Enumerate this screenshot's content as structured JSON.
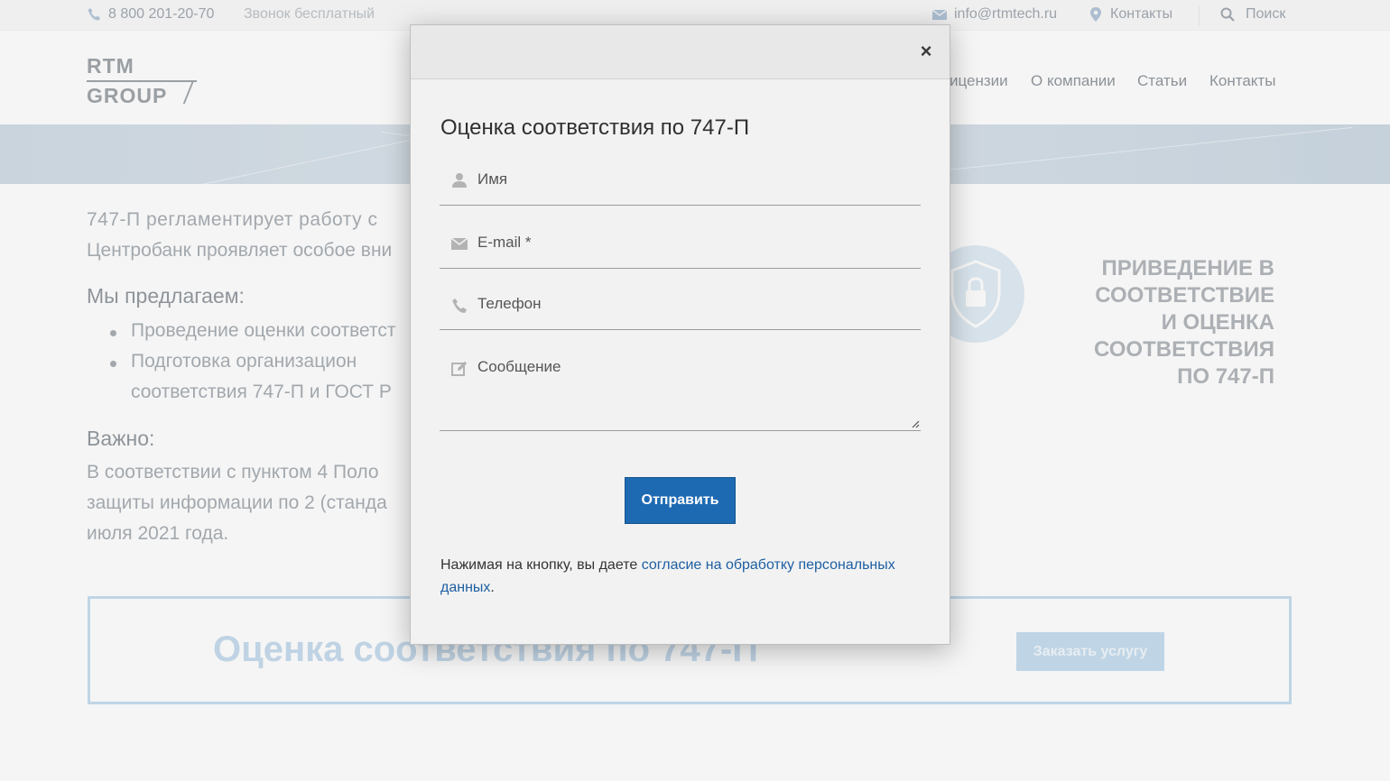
{
  "topbar": {
    "phone": "8 800 201-20-70",
    "free_call": "Звонок бесплатный",
    "email": "info@rtmtech.ru",
    "contacts": "Контакты",
    "search": "Поиск"
  },
  "logo": {
    "line1": "RTM",
    "line2": "GROUP"
  },
  "nav": {
    "items": [
      "ицензии",
      "О компании",
      "Статьи",
      "Контакты"
    ]
  },
  "content": {
    "para1_line1": "747-П  регламентирует  работу  с",
    "para1_line2": "Центробанк проявляет особое вни",
    "offer_heading": "Мы предлагаем:",
    "offer_item1": "Проведение оценки соответст",
    "offer_item2": "Подготовка       организацион",
    "offer_item2_cont": "соответствия 747-П и ГОСТ Р",
    "important_heading": "Важно:",
    "important_line1": "В  соответствии  с  пунктом  4  Поло",
    "important_line2": "защиты информации по 2 (станда",
    "important_line3": "июля 2021 года."
  },
  "promo": {
    "lines": [
      "ПРИВЕДЕНИЕ В",
      "СООТВЕТСТВИЕ",
      "И ОЦЕНКА",
      "СООТВЕТСТВИЯ",
      "ПО 747-П"
    ]
  },
  "cta": {
    "title": "Оценка соответствия по 747-П",
    "button": "Заказать услугу"
  },
  "modal": {
    "close": "×",
    "title": "Оценка соответствия по 747-П",
    "name_placeholder": "Имя",
    "email_placeholder": "E-mail *",
    "phone_placeholder": "Телефон",
    "message_placeholder": "Сообщение",
    "submit": "Отправить",
    "consent_text": "Нажимая на кнопку, вы даете ",
    "consent_link": "согласие на обработку персональных данных",
    "consent_end": "."
  },
  "colors": {
    "accent": "#1e6ab2",
    "link": "#1d5fa3",
    "cta_light": "#a9cbe6"
  }
}
